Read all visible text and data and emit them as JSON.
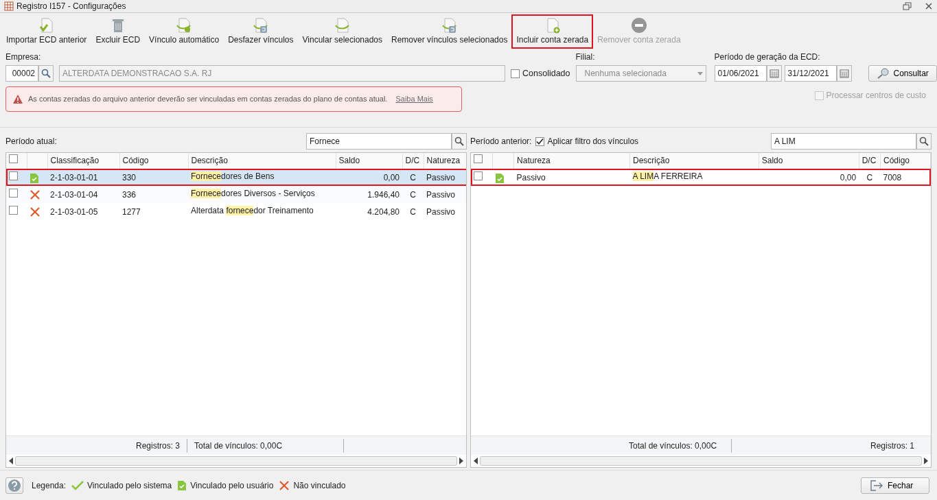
{
  "window": {
    "title": "Registro I157 - Configurações"
  },
  "toolbar": [
    {
      "label": "Importar ECD anterior",
      "disabled": false,
      "annotated": false
    },
    {
      "label": "Excluir ECD",
      "disabled": false,
      "annotated": false
    },
    {
      "label": "Vínculo automático",
      "disabled": false,
      "annotated": false
    },
    {
      "label": "Desfazer vínculos",
      "disabled": false,
      "annotated": false
    },
    {
      "label": "Vincular selecionados",
      "disabled": false,
      "annotated": false
    },
    {
      "label": "Remover vínculos selecionados",
      "disabled": false,
      "annotated": false
    },
    {
      "label": "Incluir conta zerada",
      "disabled": false,
      "annotated": true
    },
    {
      "label": "Remover conta zerada",
      "disabled": true,
      "annotated": false
    }
  ],
  "form": {
    "empresa_label": "Empresa:",
    "empresa_code": "00002",
    "empresa_name": "ALTERDATA DEMONSTRACAO S.A. RJ",
    "consolidado": {
      "label": "Consolidado",
      "checked": false
    },
    "filial_label": "Filial:",
    "filial_value": "Nenhuma selecionada",
    "periodo_label": "Período de geração da ECD:",
    "date_start": "01/06/2021",
    "date_end": "31/12/2021",
    "consultar": "Consultar",
    "processar": {
      "label": "Processar centros de custo",
      "checked": false,
      "disabled": true
    }
  },
  "alert": {
    "message": "As contas zeradas do arquivo anterior deverão ser vinculadas em contas zeradas do plano de contas atual.",
    "link": "Saiba Mais"
  },
  "left_panel": {
    "title": "Período atual:",
    "search": "Fornece",
    "select_all": {
      "checked": false
    },
    "columns": [
      {
        "label": "Classificação"
      },
      {
        "label": "Código"
      },
      {
        "label": "Descrição"
      },
      {
        "label": "Saldo"
      },
      {
        "label": "D/C"
      },
      {
        "label": "Natureza"
      }
    ],
    "rows": [
      {
        "checked": false,
        "kind": "user",
        "selected": true,
        "annotated": true,
        "cells": [
          {
            "text": "2-1-03-01-01"
          },
          {
            "text": "330"
          },
          {
            "parts": [
              {
                "text": "Fornece",
                "highlight": true
              },
              {
                "text": "dores de Bens",
                "highlight": false
              }
            ]
          },
          {
            "text": "0,00"
          },
          {
            "text": "C"
          },
          {
            "text": "Passivo"
          }
        ]
      },
      {
        "checked": false,
        "kind": "none",
        "selected": false,
        "annotated": false,
        "cells": [
          {
            "text": "2-1-03-01-04"
          },
          {
            "text": "336"
          },
          {
            "parts": [
              {
                "text": "Fornece",
                "highlight": true
              },
              {
                "text": "dores Diversos - Serviços",
                "highlight": false
              }
            ]
          },
          {
            "text": "1.946,40"
          },
          {
            "text": "C"
          },
          {
            "text": "Passivo"
          }
        ]
      },
      {
        "checked": false,
        "kind": "none",
        "selected": false,
        "annotated": false,
        "cells": [
          {
            "text": "2-1-03-01-05"
          },
          {
            "text": "1277"
          },
          {
            "parts": [
              {
                "text": "Alterdata ",
                "highlight": false
              },
              {
                "text": "fornece",
                "highlight": true
              },
              {
                "text": "dor Treinamento",
                "highlight": false
              }
            ]
          },
          {
            "text": "4.204,80"
          },
          {
            "text": "C"
          },
          {
            "text": "Passivo"
          }
        ]
      }
    ],
    "footer": [
      "Registros: 3",
      "Total de vínculos: 0,00C"
    ]
  },
  "right_panel": {
    "title": "Período anterior:",
    "filter": {
      "label": "Aplicar filtro dos vínculos",
      "checked": true
    },
    "search": "A LIM",
    "select_all": {
      "checked": false
    },
    "columns": [
      {
        "label": "Natureza"
      },
      {
        "label": "Descrição"
      },
      {
        "label": "Saldo"
      },
      {
        "label": "D/C"
      },
      {
        "label": "Código"
      }
    ],
    "rows": [
      {
        "checked": false,
        "kind": "user",
        "selected": false,
        "annotated": true,
        "cells": [
          {
            "text": "Passivo"
          },
          {
            "parts": [
              {
                "text": "A LIM",
                "highlight": true
              },
              {
                "text": "A FERREIRA",
                "highlight": false
              }
            ]
          },
          {
            "text": "0,00"
          },
          {
            "text": "C"
          },
          {
            "text": "7008"
          }
        ]
      }
    ],
    "footer": [
      "Total de vínculos: 0,00C",
      "Registros: 1"
    ]
  },
  "legend": {
    "label": "Legenda:",
    "items": [
      {
        "kind": "system",
        "label": "Vinculado pelo sistema"
      },
      {
        "kind": "user",
        "label": "Vinculado pelo usuário"
      },
      {
        "kind": "none",
        "label": "Não vinculado"
      }
    ]
  },
  "close_button": "Fechar"
}
